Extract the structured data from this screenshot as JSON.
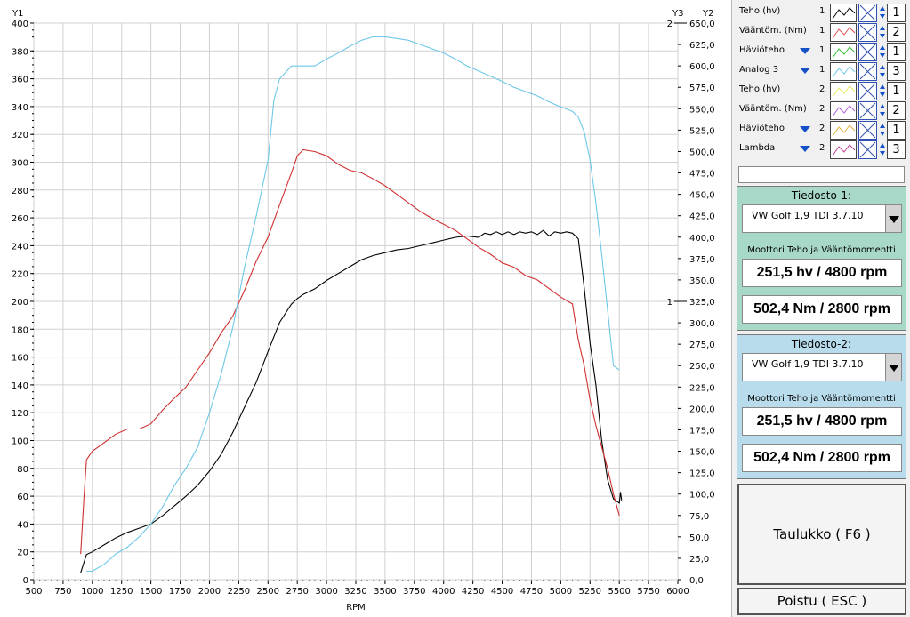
{
  "chart_data": {
    "type": "line",
    "xlabel": "RPM",
    "x_ticks": [
      500,
      750,
      1000,
      1250,
      1500,
      1750,
      2000,
      2250,
      2500,
      2750,
      3000,
      3250,
      3500,
      3750,
      4000,
      4250,
      4500,
      4750,
      5000,
      5250,
      5500,
      5750,
      6000
    ],
    "xlim": [
      500,
      6000
    ],
    "y1_label": "Y1",
    "y1_ticks": [
      0,
      20,
      40,
      60,
      80,
      100,
      120,
      140,
      160,
      180,
      200,
      220,
      240,
      260,
      280,
      300,
      320,
      340,
      360,
      380,
      400
    ],
    "y1lim": [
      0,
      400
    ],
    "y2_label": "Y2",
    "y2_ticks": [
      "0,0",
      "25,0",
      "50,0",
      "75,0",
      "100,0",
      "125,0",
      "150,0",
      "175,0",
      "200,0",
      "225,0",
      "250,0",
      "275,0",
      "300,0",
      "325,0",
      "350,0",
      "375,0",
      "400,0",
      "425,0",
      "450,0",
      "475,0",
      "500,0",
      "525,0",
      "550,0",
      "575,0",
      "600,0",
      "625,0",
      "650,0"
    ],
    "y2lim": [
      0,
      650
    ],
    "y3_label": "Y3",
    "y3_ticks": [
      {
        "label": "1",
        "value": 325
      },
      {
        "label": "2",
        "value": 650
      }
    ],
    "grid": true,
    "series": [
      {
        "color": "#000000",
        "axis": "Y1",
        "x": [
          900,
          950,
          1000,
          1100,
          1200,
          1300,
          1400,
          1500,
          1600,
          1700,
          1800,
          1900,
          2000,
          2100,
          2200,
          2300,
          2400,
          2500,
          2600,
          2700,
          2750,
          2800,
          2900,
          3000,
          3100,
          3200,
          3300,
          3400,
          3500,
          3600,
          3700,
          3800,
          3900,
          4000,
          4100,
          4200,
          4300,
          4350,
          4400,
          4450,
          4500,
          4550,
          4600,
          4650,
          4700,
          4750,
          4800,
          4850,
          4900,
          4950,
          5000,
          5050,
          5100,
          5150,
          5200,
          5250,
          5300,
          5350,
          5400,
          5450,
          5500,
          5510,
          5520
        ],
        "y": [
          5,
          18,
          20,
          25,
          30,
          34,
          37,
          40,
          46,
          53,
          60,
          68,
          78,
          90,
          106,
          124,
          142,
          164,
          185,
          198,
          202,
          205,
          209,
          215,
          220,
          225,
          230,
          233,
          235,
          237,
          238,
          240,
          242,
          244,
          246,
          247,
          246,
          249,
          248,
          250,
          248,
          250,
          248,
          250,
          249,
          250,
          248,
          251,
          247,
          250,
          249,
          250,
          249,
          245,
          210,
          170,
          140,
          100,
          72,
          58,
          55,
          63,
          57
        ]
      },
      {
        "color": "#d03030",
        "axis": "Y2",
        "x": [
          900,
          930,
          950,
          1000,
          1100,
          1200,
          1300,
          1400,
          1500,
          1600,
          1700,
          1800,
          1900,
          2000,
          2100,
          2200,
          2300,
          2400,
          2500,
          2600,
          2700,
          2750,
          2800,
          2850,
          2900,
          3000,
          3100,
          3200,
          3300,
          3400,
          3500,
          3600,
          3700,
          3800,
          3900,
          4000,
          4100,
          4200,
          4300,
          4400,
          4500,
          4600,
          4700,
          4800,
          4900,
          5000,
          5100,
          5150,
          5200,
          5250,
          5300,
          5350,
          5400,
          5450,
          5500
        ],
        "y": [
          30,
          100,
          140,
          150,
          160,
          170,
          176,
          176,
          182,
          198,
          212,
          225,
          245,
          265,
          288,
          308,
          338,
          372,
          400,
          438,
          475,
          495,
          502,
          501,
          500,
          495,
          485,
          478,
          475,
          468,
          460,
          450,
          440,
          430,
          422,
          415,
          408,
          398,
          388,
          380,
          370,
          365,
          355,
          350,
          340,
          330,
          322,
          280,
          250,
          210,
          180,
          155,
          130,
          100,
          75
        ]
      },
      {
        "color": "#6ec8e8",
        "axis": "Y2",
        "x": [
          950,
          1000,
          1100,
          1200,
          1300,
          1400,
          1500,
          1600,
          1700,
          1800,
          1900,
          2000,
          2100,
          2200,
          2300,
          2400,
          2500,
          2550,
          2600,
          2700,
          2800,
          2900,
          3000,
          3100,
          3200,
          3300,
          3400,
          3500,
          3600,
          3700,
          3800,
          3900,
          4000,
          4100,
          4200,
          4300,
          4400,
          4500,
          4600,
          4700,
          4800,
          4900,
          5000,
          5100,
          5150,
          5200,
          5250,
          5300,
          5350,
          5400,
          5450,
          5500
        ],
        "y": [
          10,
          10,
          18,
          30,
          38,
          50,
          65,
          85,
          110,
          130,
          155,
          195,
          240,
          295,
          365,
          425,
          490,
          560,
          585,
          600,
          600,
          600,
          608,
          615,
          623,
          630,
          634,
          634,
          632,
          630,
          625,
          620,
          615,
          608,
          600,
          594,
          588,
          582,
          575,
          570,
          565,
          558,
          552,
          547,
          540,
          523,
          490,
          440,
          380,
          315,
          250,
          245
        ]
      }
    ]
  },
  "legend": [
    {
      "name": "Teho (hv)",
      "arrow": false,
      "num": "1",
      "color": "#000000",
      "axis": "1"
    },
    {
      "name": "Vääntöm. (Nm)",
      "arrow": false,
      "num": "1",
      "color": "#e05050",
      "axis": "2"
    },
    {
      "name": "Häviöteho",
      "arrow": true,
      "num": "1",
      "color": "#30c030",
      "axis": "1"
    },
    {
      "name": "Analog 3",
      "arrow": true,
      "num": "1",
      "color": "#6ec8e8",
      "axis": "3"
    },
    {
      "name": "Teho (hv)",
      "arrow": false,
      "num": "2",
      "color": "#e8e860",
      "axis": "1"
    },
    {
      "name": "Vääntöm. (Nm)",
      "arrow": false,
      "num": "2",
      "color": "#b060e0",
      "axis": "2"
    },
    {
      "name": "Häviöteho",
      "arrow": true,
      "num": "2",
      "color": "#e8b040",
      "axis": "1"
    },
    {
      "name": "Lambda",
      "arrow": true,
      "num": "2",
      "color": "#c04090",
      "axis": "3"
    }
  ],
  "file1": {
    "title": "Tiedosto-1:",
    "selected": "VW Golf 1,9 TDI 3.7.10",
    "subtitle": "Moottori Teho ja Vääntömomentti",
    "power": "251,5 hv / 4800 rpm",
    "torque": "502,4 Nm / 2800 rpm",
    "bg": "#a8d8c8"
  },
  "file2": {
    "title": "Tiedosto-2:",
    "selected": "VW Golf 1,9 TDI 3.7.10",
    "subtitle": "Moottori Teho ja Vääntömomentti",
    "power": "251,5 hv / 4800 rpm",
    "torque": "502,4 Nm / 2800 rpm",
    "bg": "#b8dcec"
  },
  "buttons": {
    "table": "Taulukko ( F6 )",
    "exit": "Poistu ( ESC )"
  }
}
